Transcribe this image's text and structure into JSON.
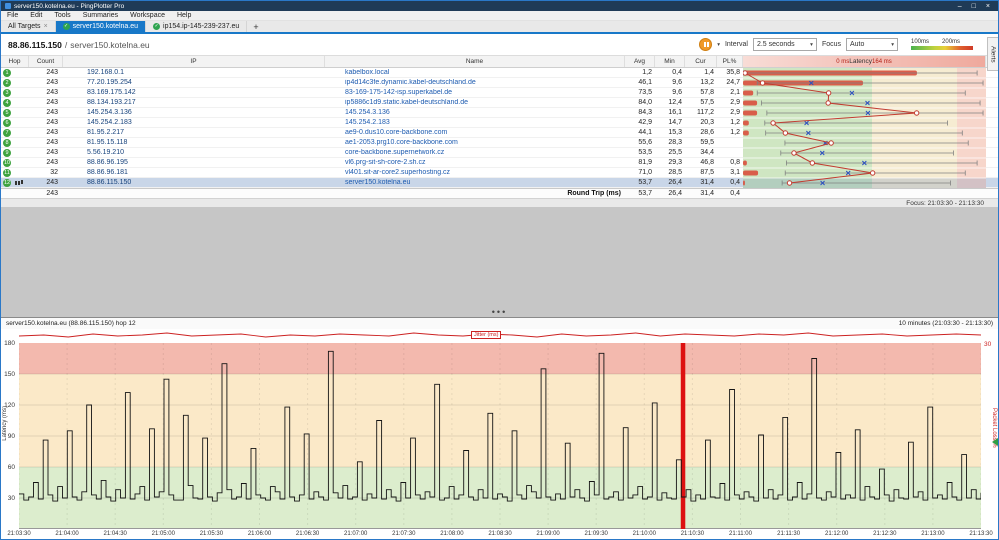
{
  "window": {
    "title": "server150.kotelna.eu - PingPlotter Pro",
    "controls": {
      "minimize": "–",
      "maximize": "□",
      "close": "×"
    }
  },
  "menu": {
    "items": [
      "File",
      "Edit",
      "Tools",
      "Summaries",
      "Workspace",
      "Help"
    ]
  },
  "tabs": {
    "items": [
      {
        "label": "All Targets"
      },
      {
        "label": "server150.kotelna.eu"
      },
      {
        "label": "ip154.ip-145-239-237.eu"
      }
    ],
    "new_tab": "+"
  },
  "toolbar": {
    "target_ip": "88.86.115.150",
    "sep": "/",
    "target_host": "server150.kotelna.eu",
    "interval_label": "Interval",
    "interval_value": "2.5 seconds",
    "focus_label": "Focus",
    "focus_value": "Auto",
    "legend_100": "100ms",
    "legend_200": "200ms",
    "alerts_label": "Alerts"
  },
  "ui": {
    "caret": "▾",
    "check": "✓",
    "close_x": "×",
    "splitter_dots": "•••"
  },
  "table": {
    "headers": {
      "hop": "Hop",
      "count": "Count",
      "ip": "IP",
      "name": "Name",
      "avg": "Avg",
      "min": "Min",
      "cur": "Cur",
      "pl": "PL%"
    },
    "latency_header": {
      "left": "0 ms",
      "center": "Latency",
      "right": "164 ms"
    },
    "hops": [
      {
        "hop": "1",
        "count": "243",
        "ip": "192.168.0.1",
        "name": "kabelbox.local",
        "avg": "1,2",
        "min": "0,4",
        "cur": "1,4",
        "pl": "35,8"
      },
      {
        "hop": "2",
        "count": "243",
        "ip": "77.20.195.254",
        "name": "ip4d14c3fe.dynamic.kabel-deutschland.de",
        "avg": "46,1",
        "min": "9,6",
        "cur": "13,2",
        "pl": "24,7"
      },
      {
        "hop": "3",
        "count": "243",
        "ip": "83.169.175.142",
        "name": "83-169-175-142-isp.superkabel.de",
        "avg": "73,5",
        "min": "9,6",
        "cur": "57,8",
        "pl": "2,1"
      },
      {
        "hop": "4",
        "count": "243",
        "ip": "88.134.193.217",
        "name": "ip5886c1d9.static.kabel-deutschland.de",
        "avg": "84,0",
        "min": "12,4",
        "cur": "57,5",
        "pl": "2,9"
      },
      {
        "hop": "5",
        "count": "243",
        "ip": "145.254.3.136",
        "name": "145.254.3.136",
        "avg": "84,3",
        "min": "16,1",
        "cur": "117,2",
        "pl": "2,9"
      },
      {
        "hop": "6",
        "count": "243",
        "ip": "145.254.2.183",
        "name": "145.254.2.183",
        "avg": "42,9",
        "min": "14,7",
        "cur": "20,3",
        "pl": "1,2"
      },
      {
        "hop": "7",
        "count": "243",
        "ip": "81.95.2.217",
        "name": "ae9-0.dus10.core-backbone.com",
        "avg": "44,1",
        "min": "15,3",
        "cur": "28,6",
        "pl": "1,2"
      },
      {
        "hop": "8",
        "count": "243",
        "ip": "81.95.15.118",
        "name": "ae1-2053.prg10.core-backbone.com",
        "avg": "55,6",
        "min": "28,3",
        "cur": "59,5",
        "pl": ""
      },
      {
        "hop": "9",
        "count": "243",
        "ip": "5.56.19.210",
        "name": "core-backbone.supernetwork.cz",
        "avg": "53,5",
        "min": "25,5",
        "cur": "34,4",
        "pl": ""
      },
      {
        "hop": "10",
        "count": "243",
        "ip": "88.86.96.195",
        "name": "vl6.prg-sit-sh-core-2.sh.cz",
        "avg": "81,9",
        "min": "29,3",
        "cur": "46,8",
        "pl": "0,8"
      },
      {
        "hop": "11",
        "count": "32",
        "ip": "88.86.96.181",
        "name": "vl401.sit-ar-core2.superhosting.cz",
        "avg": "71,0",
        "min": "28,5",
        "cur": "87,5",
        "pl": "3,1"
      },
      {
        "hop": "12",
        "count": "243",
        "ip": "88.86.115.150",
        "name": "server150.kotelna.eu",
        "avg": "53,7",
        "min": "26,4",
        "cur": "31,4",
        "pl": "0,4",
        "highlight": true
      }
    ],
    "summary": {
      "count": "243",
      "label": "Round Trip (ms)",
      "avg": "53,7",
      "min": "26,4",
      "cur": "31,4",
      "pl": "0,4"
    },
    "focus_text": "Focus: 21:03:30 - 21:13:30"
  },
  "timegraph": {
    "title": "server150.kotelna.eu (88.86.115.150) hop 12",
    "range_text": "10 minutes (21:03:30 - 21:13:30)",
    "jitter_label": "Jitter (ms)",
    "left_axis_label": "Latency (ms)",
    "right_axis_label": "Packet Loss %",
    "right_top_tick": "30"
  },
  "chart_data": [
    {
      "name": "hop-latency-strip",
      "type": "scatter",
      "xlabel": "Latency (ms)",
      "xlim": [
        0,
        164
      ],
      "rows": [
        {
          "hop": 1,
          "min": 0.4,
          "avg": 1.2,
          "cur": 1.4,
          "max": 158,
          "packet_loss_pct": 35.8
        },
        {
          "hop": 2,
          "min": 9.6,
          "avg": 46.1,
          "cur": 13.2,
          "max": 162,
          "packet_loss_pct": 24.7
        },
        {
          "hop": 3,
          "min": 9.6,
          "avg": 73.5,
          "cur": 57.8,
          "max": 150,
          "packet_loss_pct": 2.1
        },
        {
          "hop": 4,
          "min": 12.4,
          "avg": 84.0,
          "cur": 57.5,
          "max": 160,
          "packet_loss_pct": 2.9
        },
        {
          "hop": 5,
          "min": 16.1,
          "avg": 84.3,
          "cur": 117.2,
          "max": 162,
          "packet_loss_pct": 2.9
        },
        {
          "hop": 6,
          "min": 14.7,
          "avg": 42.9,
          "cur": 20.3,
          "max": 138,
          "packet_loss_pct": 1.2
        },
        {
          "hop": 7,
          "min": 15.3,
          "avg": 44.1,
          "cur": 28.6,
          "max": 148,
          "packet_loss_pct": 1.2
        },
        {
          "hop": 8,
          "min": 28.3,
          "avg": 55.6,
          "cur": 59.5,
          "max": 152,
          "packet_loss_pct": 0
        },
        {
          "hop": 9,
          "min": 25.5,
          "avg": 53.5,
          "cur": 34.4,
          "max": 142,
          "packet_loss_pct": 0
        },
        {
          "hop": 10,
          "min": 29.3,
          "avg": 81.9,
          "cur": 46.8,
          "max": 158,
          "packet_loss_pct": 0.8
        },
        {
          "hop": 11,
          "min": 28.5,
          "avg": 71.0,
          "cur": 87.5,
          "max": 150,
          "packet_loss_pct": 3.1
        },
        {
          "hop": 12,
          "min": 26.4,
          "avg": 53.7,
          "cur": 31.4,
          "max": 140,
          "packet_loss_pct": 0.4
        }
      ]
    },
    {
      "name": "hop12-timeline",
      "type": "line",
      "title": "server150.kotelna.eu (88.86.115.150) hop 12",
      "ylim": [
        0,
        180
      ],
      "right_axis_max": 30,
      "y_ticks": [
        30,
        60,
        90,
        120,
        150,
        180
      ],
      "x_ticks": [
        "21:03:30",
        "21:04:00",
        "21:04:30",
        "21:05:00",
        "21:05:30",
        "21:06:00",
        "21:06:30",
        "21:07:00",
        "21:07:30",
        "21:08:00",
        "21:08:30",
        "21:09:00",
        "21:09:30",
        "21:10:00",
        "21:10:30",
        "21:11:00",
        "21:11:30",
        "21:12:00",
        "21:12:30",
        "21:13:00",
        "21:13:30"
      ],
      "bands": [
        {
          "range": [
            0,
            60
          ],
          "color": "#dcedcd"
        },
        {
          "range": [
            60,
            150
          ],
          "color": "#fbe9c8"
        },
        {
          "range": [
            150,
            180
          ],
          "color": "#f3b9ae"
        }
      ],
      "packet_loss_marker_fraction": 0.69,
      "latency_series": [
        34,
        28,
        31,
        45,
        29,
        86,
        33,
        27,
        41,
        30,
        95,
        31,
        28,
        36,
        120,
        33,
        29,
        47,
        31,
        27,
        38,
        30,
        132,
        29,
        34,
        41,
        28,
        97,
        31,
        36,
        145,
        33,
        28,
        28,
        110,
        42,
        30,
        29,
        88,
        31,
        27,
        35,
        160,
        38,
        29,
        31,
        44,
        29,
        78,
        33,
        30,
        28,
        41,
        36,
        29,
        118,
        31,
        27,
        33,
        92,
        29,
        36,
        31,
        28,
        172,
        35,
        30,
        42,
        29,
        31,
        65,
        28,
        34,
        30,
        105,
        29,
        38,
        31,
        27,
        45,
        30,
        88,
        33,
        29,
        36,
        31,
        140,
        28,
        30,
        41,
        29,
        33,
        76,
        31,
        28,
        38,
        30,
        112,
        29,
        34,
        31,
        27,
        95,
        33,
        29,
        42,
        36,
        30,
        155,
        31,
        28,
        34,
        29,
        83,
        31,
        38,
        30,
        27,
        46,
        33,
        170,
        29,
        31,
        36,
        28,
        98,
        30,
        33,
        41,
        29,
        31,
        122,
        28,
        35,
        30,
        29,
        67,
        31,
        38,
        27,
        33,
        29,
        86,
        31,
        30,
        44,
        28,
        135,
        33,
        29,
        36,
        31,
        27,
        91,
        30,
        38,
        29,
        33,
        108,
        28,
        31,
        45,
        29,
        34,
        165,
        30,
        28,
        36,
        31,
        74,
        29,
        33,
        30,
        96,
        28,
        41,
        31,
        29,
        58,
        33,
        27,
        38,
        30,
        29,
        84,
        31,
        36,
        28,
        118,
        30,
        33,
        29,
        45,
        31,
        28,
        72,
        30,
        38,
        29,
        35
      ],
      "jitter_series": [
        4,
        5,
        3,
        6,
        4,
        5,
        7,
        4,
        5,
        6,
        3,
        5,
        4,
        6,
        5,
        4,
        7,
        5,
        4,
        6,
        5,
        3,
        6,
        4,
        5,
        7,
        4,
        6,
        5,
        4,
        6,
        5,
        7,
        4,
        5,
        6,
        4,
        5,
        6,
        5
      ]
    }
  ]
}
